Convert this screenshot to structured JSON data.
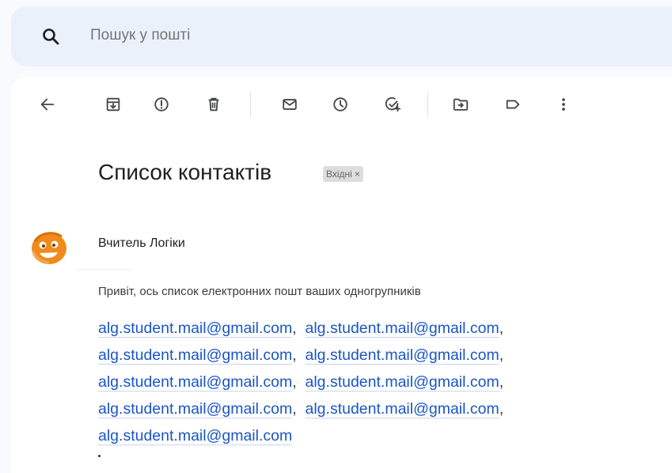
{
  "search": {
    "placeholder": "Пошук у пошті"
  },
  "toolbar": {
    "back": "arrow-back-icon",
    "archive": "archive-icon",
    "spam": "report-spam-icon",
    "delete": "trash-icon",
    "mark_unread": "mail-icon",
    "snooze": "clock-icon",
    "add_task": "add-task-icon",
    "move_to": "move-to-folder-icon",
    "labels": "label-icon",
    "more": "more-vert-icon"
  },
  "message": {
    "subject": "Список контактів",
    "label": "Вхідні",
    "label_remove": "×",
    "sender": "Вчитель Логіки",
    "body": "Привіт, ось список електронних пошт ваших одногрупників",
    "emails": [
      "alg.student.mail@gmail.com",
      "alg.student.mail@gmail.com",
      "alg.student.mail@gmail.com",
      "alg.student.mail@gmail.com",
      "alg.student.mail@gmail.com",
      "alg.student.mail@gmail.com",
      "alg.student.mail@gmail.com",
      "alg.student.mail@gmail.com",
      "alg.student.mail@gmail.com"
    ],
    "separator": ","
  },
  "colors": {
    "search_bg": "#eaf1fb",
    "link": "#1a56c4",
    "avatar": "#f08a1c"
  }
}
